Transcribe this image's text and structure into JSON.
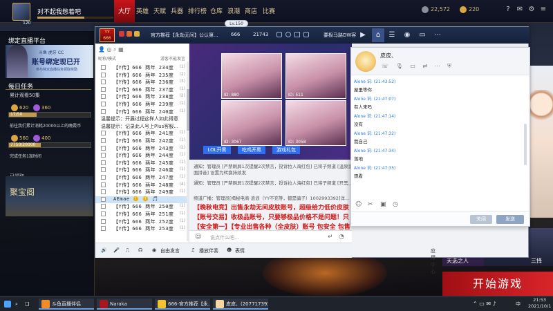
{
  "game": {
    "username": "对不起我憋着吧",
    "level": "120",
    "nav": [
      "大厅",
      "英雄",
      "天赋",
      "兵器",
      "排行榜",
      "仓库",
      "浪潮",
      "商店",
      "比赛"
    ],
    "nav_active": "大厅",
    "coins": "22,572",
    "gold": "220",
    "start_button": "开始游戏",
    "promo_right": "三择",
    "promo_left": "天选之人"
  },
  "left": {
    "bind_title": "绑定直播平台",
    "banner_line1": "斗鱼 虎牙 CC",
    "banner_line2": "账号绑定现已开",
    "banner_line3": "参与特定直播任务领取奖励",
    "daily_title": "每日任务",
    "task1": "累计观看50集",
    "task1_progress": "17/50",
    "task1_reward_a": "620",
    "task1_reward_b": "360",
    "task2": "前往我们累计消耗20000以上的晚霞币",
    "task2_progress": "7750/20000",
    "task2_reward_a": "560",
    "task2_reward_b": "400",
    "done_text": "完成任务1加时间",
    "claimed": "已领取",
    "bottom_banner": "聚宝阁"
  },
  "qq": {
    "level_pill": "Lv.150",
    "title": "官方推荐【永劫无间】公认第...",
    "id_label": "666",
    "count": "21743",
    "group_label": "要极马路DW客",
    "list_header_left": "昵称/模式",
    "list_header_right": "游客不能发言",
    "members": [
      "【Y传】666 两年 234度",
      "【Y传】666 两年 235度",
      "【Y传】666 两年 236度",
      "【Y传】666 两年 237度",
      "【Y传】666 两年 238度",
      "【Y传】666 两年 239度",
      "【Y传】666 两年 240度",
      "温馨提示：开展过程这样人如此得意",
      "温馨提示：记录此人号上Plus客服...",
      "【Y传】666 两年 241度",
      "【Y传】666 两年 242度",
      "【Y传】666 两年 243度",
      "【Y传】666 两年 244度",
      "【Y传】666 两年 245度",
      "【Y传】666 两年 246度",
      "【Y传】666 两年 247度",
      "【Y传】666 两年 248度",
      "【Y传】666 两年 249度",
      "AEmae 😊 😊 🎵",
      "【Y传】666 两年 250度",
      "【Y传】666 两年 251度",
      "【Y传】666 两年 252度",
      "【Y传】666 两年 253度"
    ],
    "member_counts": [
      "(1)",
      "(2)",
      "(3)",
      "(1)",
      "(2)",
      "(1)",
      "(1)",
      "",
      "",
      "(1)",
      "(1)",
      "(2)",
      "(1)",
      "(1)",
      "(1)",
      "(1)",
      "(4)",
      "(1)",
      "",
      "(1)",
      "(1)",
      "(1)",
      "(1)"
    ],
    "thumb_ids": [
      "ID: 880",
      "ID: 511",
      "ID: 3067",
      "ID: 3058"
    ],
    "thumb_captions": [
      "带着主女粉丝直播",
      "",
      "这是全部就有些好",
      "欢迎加入小朋友"
    ],
    "stream_buttons": [
      "LOL开黑",
      "吃鸡开黑",
      "游戏礼包"
    ],
    "notice1": "通知：管理员 [严禁刷屏1次提醒2次禁言，投诉拉人海红包] 已将子频道 [温泉里面拼音] 设置为转换持续发",
    "notice2": "通知：管理员 [严禁刷屏1次提醒2次禁言，投诉拉人海红包] 已将子频道 [开黑...",
    "notice3": "频道广播：管理员[揭秘电商·浪浪（YY不充等，都是骗子）1002993392]详...",
    "red1": "【晚秋电竞】出售永劫无间皮肤账号，超级给力低价皮肤",
    "red2": "【账号交易】收极品账号，只要够极品价格不是问题！只",
    "red3": "【安全第一】【专业出售各种（全皮肤）账号 包安全 包售后",
    "input_placeholder": "说点什么吧...",
    "bottom_tools": [
      "自由发言",
      "播放伴奏",
      "表情"
    ],
    "bottom_right": "应用中心"
  },
  "pm": {
    "name": "皮皮、",
    "messages": [
      {
        "head": "Alone 说: (21:43:52)",
        "text": "屋里等你"
      },
      {
        "head": "Alone 说: (21:47:07)",
        "text": "有人来吗"
      },
      {
        "head": "Alone 说: (21:47:14)",
        "text": "没有"
      },
      {
        "head": "Alone 说: (21:47:32)",
        "text": "我自己"
      },
      {
        "head": "Alone 说: (21:47:34)",
        "text": "落地"
      },
      {
        "head": "Alone 说: (21:47:35)",
        "text": "观看"
      }
    ],
    "close_label": "关闭",
    "send_label": "发送"
  },
  "taskbar": {
    "items": [
      "斗鱼直播伴侣",
      "Naraka",
      "666-官方推荐【永...",
      "皮皮、(2077173935)"
    ],
    "ime": "中",
    "time": "21:53",
    "date": "2021/10/1"
  }
}
